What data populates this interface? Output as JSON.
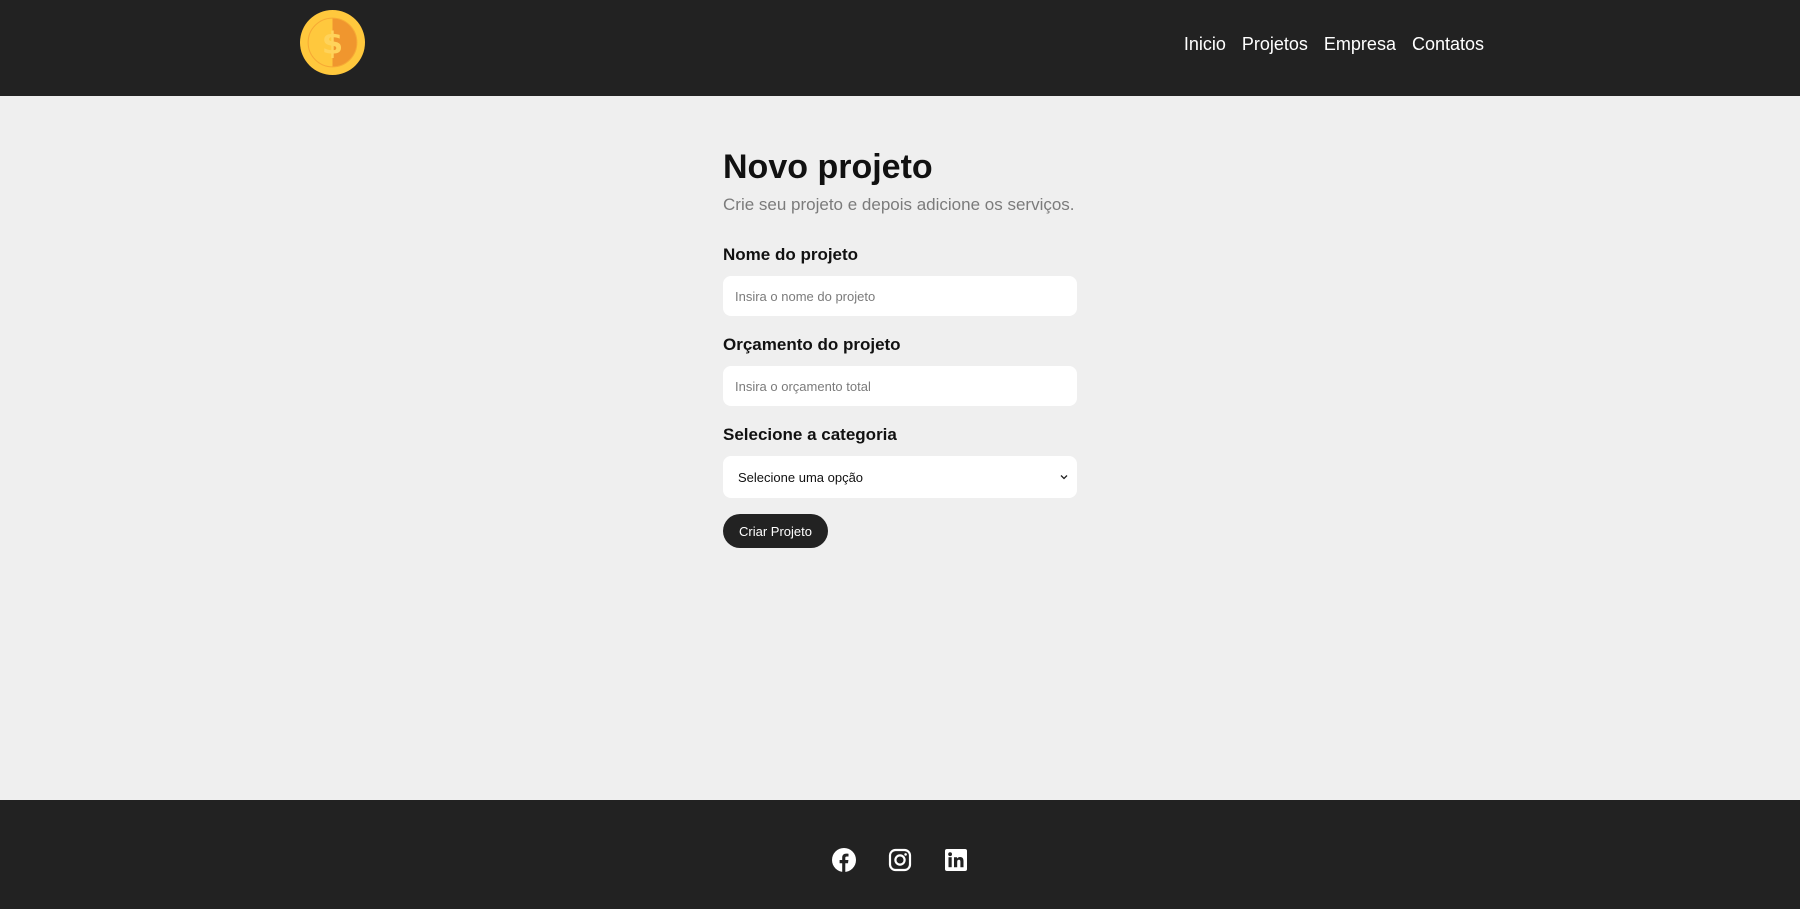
{
  "navbar": {
    "logo_icon": "coin-dollar-icon",
    "links": [
      {
        "label": "Inicio"
      },
      {
        "label": "Projetos"
      },
      {
        "label": "Empresa"
      },
      {
        "label": "Contatos"
      }
    ]
  },
  "main": {
    "title": "Novo projeto",
    "subtitle": "Crie seu projeto e depois adicione os serviços.",
    "form": {
      "name_label": "Nome do projeto",
      "name_placeholder": "Insira o nome do projeto",
      "budget_label": "Orçamento do projeto",
      "budget_placeholder": "Insira o orçamento total",
      "category_label": "Selecione a categoria",
      "category_selected": "Selecione uma opção",
      "submit_label": "Criar Projeto"
    }
  },
  "footer": {
    "social_icons": [
      "facebook-icon",
      "instagram-icon",
      "linkedin-icon"
    ]
  },
  "colors": {
    "header_bg": "#222222",
    "page_bg": "#efefef",
    "footer_bg": "#222222",
    "coin_gold": "#ffc83d",
    "coin_orange": "#f0962e"
  }
}
